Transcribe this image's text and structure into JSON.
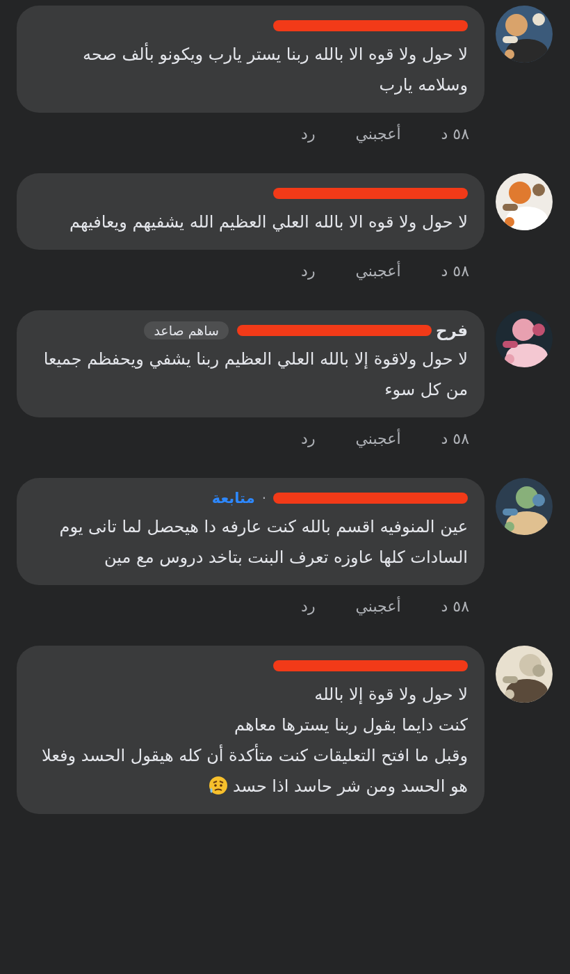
{
  "comments": [
    {
      "text": "لا حول ولا قوه الا بالله ربنا يستر يارب ويكونو بألف صحه وسلامه يارب",
      "time": "٥٨ د",
      "like": "أعجبني",
      "reply": "رد",
      "redacted": true
    },
    {
      "text": "لا حول ولا قوه الا بالله العلي العظيم الله يشفيهم ويعافيهم",
      "time": "٥٨ د",
      "like": "أعجبني",
      "reply": "رد",
      "redacted": true
    },
    {
      "author": "فرح",
      "badge": "ساهم صاعد",
      "text": "لا حول ولاقوة إلا بالله العلي العظيم ربنا يشفي ويحفظم جميعا من كل سوء",
      "time": "٥٨ د",
      "like": "أعجبني",
      "reply": "رد",
      "redacted": true
    },
    {
      "separator": "·",
      "follow": "متابعة",
      "text": "عين المنوفيه اقسم بالله كنت عارفه دا هيحصل لما تانى يوم السادات كلها عاوزه تعرف البنت بتاخد دروس مع مين",
      "time": "٥٨ د",
      "like": "أعجبني",
      "reply": "رد",
      "redacted": true
    },
    {
      "text": "لا حول ولا قوة إلا بالله\nكنت دايما بقول ربنا يسترها معاهم\nوقبل ما افتح التعليقات كنت متأكدة أن كله هيقول الحسد وفعلا هو الحسد ومن شر حاسد اذا حسد",
      "trailing_emoji": true,
      "redacted": true
    }
  ]
}
